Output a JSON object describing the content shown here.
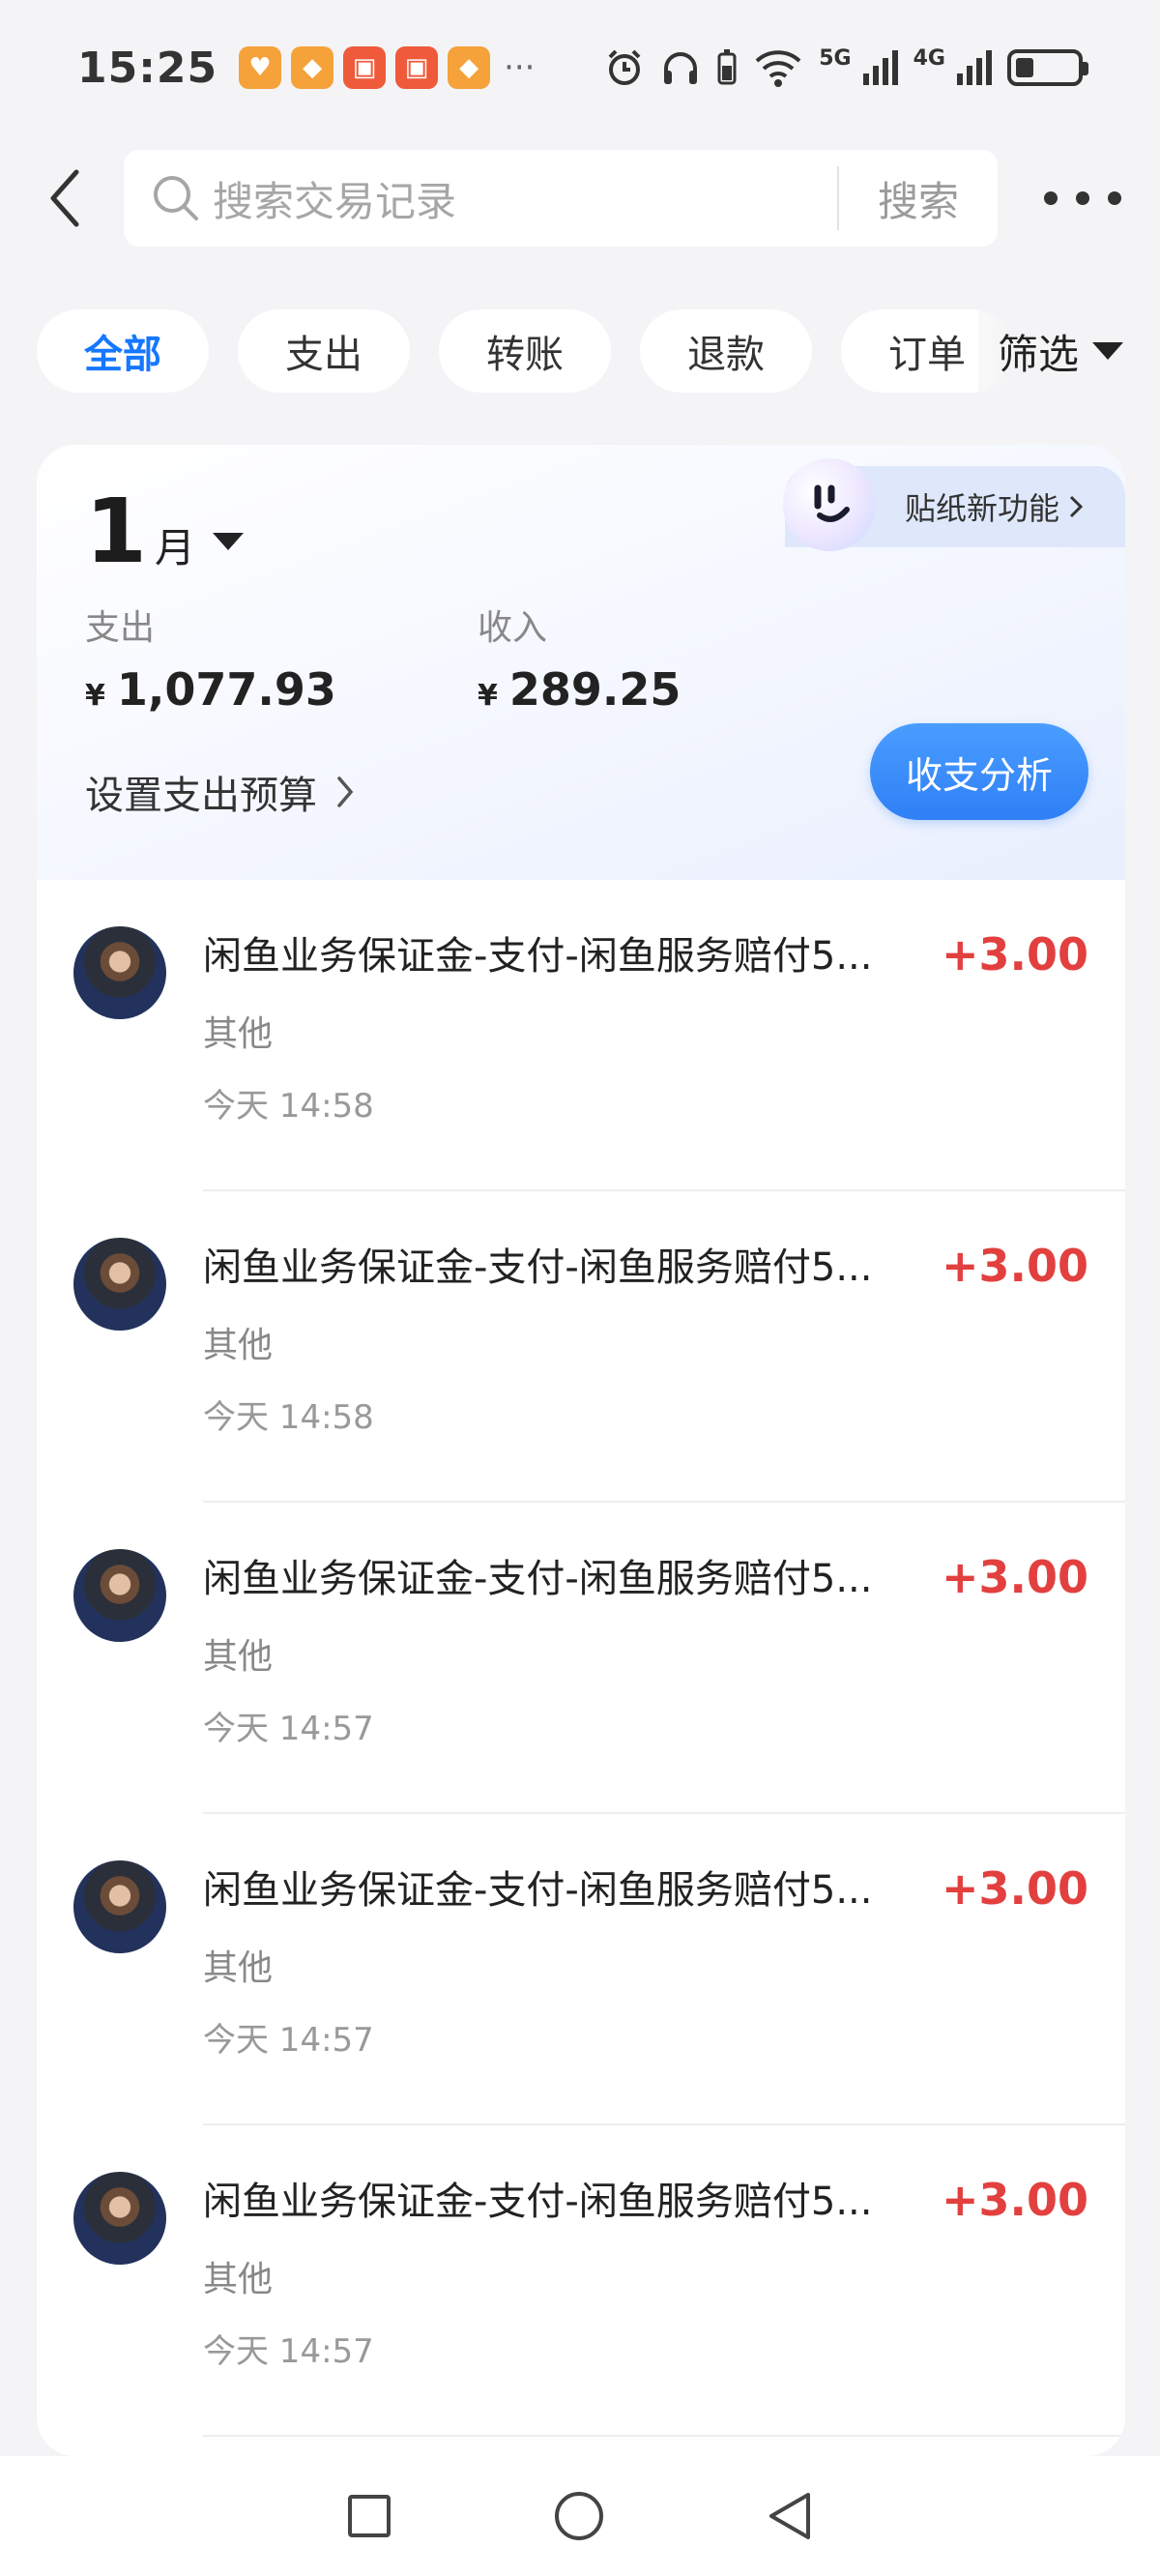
{
  "status_bar": {
    "time": "15:25",
    "notifications": [
      "orange-heart-app",
      "orange-app",
      "red-app",
      "red-app",
      "orange-app"
    ],
    "more": "···",
    "signal_5g": "5G",
    "signal_4g": "4G",
    "battery_level": 0.25
  },
  "header": {
    "search_placeholder": "搜索交易记录",
    "search_button": "搜索"
  },
  "filters": {
    "chips": [
      {
        "label": "全部",
        "active": true
      },
      {
        "label": "支出",
        "active": false
      },
      {
        "label": "转账",
        "active": false
      },
      {
        "label": "退款",
        "active": false
      },
      {
        "label": "订单",
        "active": false
      }
    ],
    "filter_label": "筛选"
  },
  "summary": {
    "month_num": "1",
    "month_unit": "月",
    "sticker_label": "贴纸新功能",
    "expense_label": "支出",
    "expense_currency": "¥",
    "expense_value": "1,077.93",
    "income_label": "收入",
    "income_currency": "¥",
    "income_value": "289.25",
    "budget_label": "设置支出预算",
    "analysis_button": "收支分析"
  },
  "transactions": [
    {
      "title": "闲鱼业务保证金-支付-闲鱼服务赔付5...",
      "category": "其他",
      "time": "今天 14:58",
      "amount": "+3.00"
    },
    {
      "title": "闲鱼业务保证金-支付-闲鱼服务赔付5...",
      "category": "其他",
      "time": "今天 14:58",
      "amount": "+3.00"
    },
    {
      "title": "闲鱼业务保证金-支付-闲鱼服务赔付5...",
      "category": "其他",
      "time": "今天 14:57",
      "amount": "+3.00"
    },
    {
      "title": "闲鱼业务保证金-支付-闲鱼服务赔付5...",
      "category": "其他",
      "time": "今天 14:57",
      "amount": "+3.00"
    },
    {
      "title": "闲鱼业务保证金-支付-闲鱼服务赔付5...",
      "category": "其他",
      "time": "今天 14:57",
      "amount": "+3.00"
    }
  ],
  "colors": {
    "accent": "#1677ff",
    "income_amount": "#e2403f",
    "background": "#f4f4f6"
  }
}
